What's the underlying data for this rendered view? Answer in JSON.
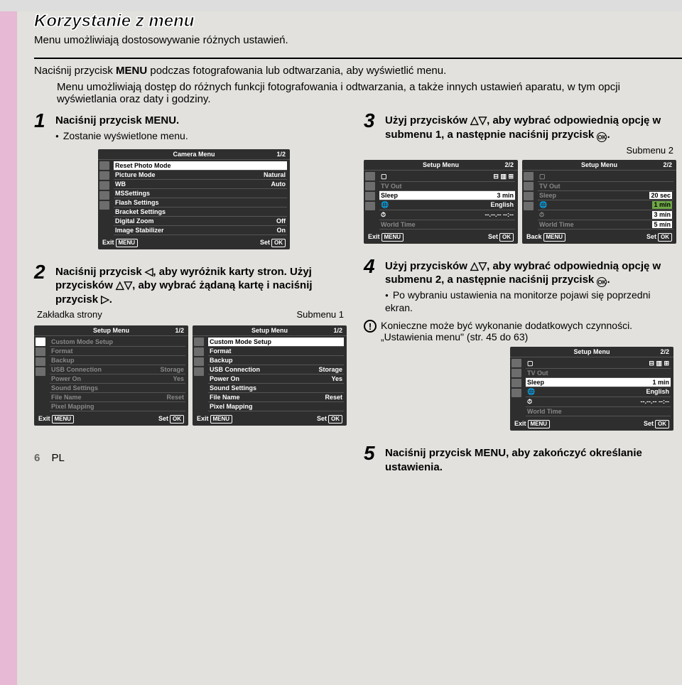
{
  "page": {
    "title": "Korzystanie z menu",
    "subtitle": "Menu umożliwiają dostosowywanie różnych ustawień.",
    "intro_line": "Naciśnij przycisk MENU podczas fotografowania lub odtwarzania, aby wyświetlić menu.",
    "intro_body": "Menu umożliwiają dostęp do różnych funkcji fotografowania i odtwarzania, a także innych ustawień aparatu, w tym opcji wyświetlania oraz daty i godziny.",
    "page_num": "6",
    "lang": "PL"
  },
  "step1": {
    "num": "1",
    "text": "Naciśnij przycisk MENU.",
    "bullet": "Zostanie wyświetlone menu."
  },
  "step2": {
    "num": "2",
    "text_a": "Naciśnij przycisk ◁, aby wyróżnik karty stron. Użyj przycisków △▽, aby wybrać żądaną kartę i naciśnij przycisk ▷.",
    "cap_left": "Zakładka strony",
    "cap_right": "Submenu 1"
  },
  "step3": {
    "num": "3",
    "text": "Użyj przycisków △▽, aby wybrać odpowiednią opcję w submenu 1, a następnie naciśnij przycisk",
    "side_label": "Submenu 2"
  },
  "step4": {
    "num": "4",
    "text": "Użyj przycisków △▽, aby wybrać odpowiednią opcję w submenu 2, a następnie naciśnij przycisk",
    "bullet": "Po wybraniu ustawienia na monitorze pojawi się poprzedni ekran.",
    "warn1": "Konieczne może być wykonanie dodatkowych czynności.",
    "warn2": "„Ustawienia menu\" (str. 45 do 63)"
  },
  "step5": {
    "num": "5",
    "text": "Naciśnij przycisk MENU, aby zakończyć określanie ustawienia."
  },
  "lcd_camera": {
    "title": "Camera Menu",
    "pager": "1/2",
    "rows": [
      {
        "l": "Reset Photo Mode",
        "r": ""
      },
      {
        "l": "Picture Mode",
        "r": "Natural"
      },
      {
        "l": "WB",
        "r": "Auto"
      },
      {
        "l": "MSSettings",
        "r": ""
      },
      {
        "l": "Flash Settings",
        "r": ""
      },
      {
        "l": "Bracket Settings",
        "r": ""
      },
      {
        "l": "Digital Zoom",
        "r": "Off"
      },
      {
        "l": "Image Stabilizer",
        "r": "On"
      }
    ],
    "exit": "Exit",
    "exit_btn": "MENU",
    "set": "Set",
    "set_btn": "OK"
  },
  "lcd_setup12": {
    "title": "Setup Menu",
    "pager": "1/2",
    "rows": [
      {
        "l": "Custom Mode Setup",
        "r": ""
      },
      {
        "l": "Format",
        "r": ""
      },
      {
        "l": "Backup",
        "r": ""
      },
      {
        "l": "USB Connection",
        "r": "Storage"
      },
      {
        "l": "Power On",
        "r": "Yes"
      },
      {
        "l": "Sound Settings",
        "r": ""
      },
      {
        "l": "File Name",
        "r": "Reset"
      },
      {
        "l": "Pixel Mapping",
        "r": ""
      }
    ]
  },
  "lcd_setup22": {
    "title": "Setup Menu",
    "pager": "2/2",
    "rows": [
      {
        "l": "",
        "r": ""
      },
      {
        "l": "TV Out",
        "r": ""
      },
      {
        "l": "Sleep",
        "r": "3 min"
      },
      {
        "l": "",
        "r": "English"
      },
      {
        "l": "",
        "r": "--.--.-- --:--"
      },
      {
        "l": "World Time",
        "r": ""
      }
    ]
  },
  "lcd_setup22_popup": {
    "rows": [
      {
        "l": "20 sec"
      },
      {
        "l": "1 min"
      },
      {
        "l": "3 min"
      },
      {
        "l": "5 min"
      }
    ]
  },
  "lcd_setup22_after": {
    "title": "Setup Menu",
    "pager": "2/2",
    "rows": [
      {
        "l": "",
        "r": ""
      },
      {
        "l": "TV Out",
        "r": ""
      },
      {
        "l": "Sleep",
        "r": "1 min"
      },
      {
        "l": "",
        "r": "English"
      },
      {
        "l": "",
        "r": "--.--.-- --:--"
      },
      {
        "l": "World Time",
        "r": ""
      }
    ]
  },
  "lcd_common": {
    "exit": "Exit",
    "exit_btn": "MENU",
    "set": "Set",
    "set_btn": "OK",
    "back": "Back"
  }
}
